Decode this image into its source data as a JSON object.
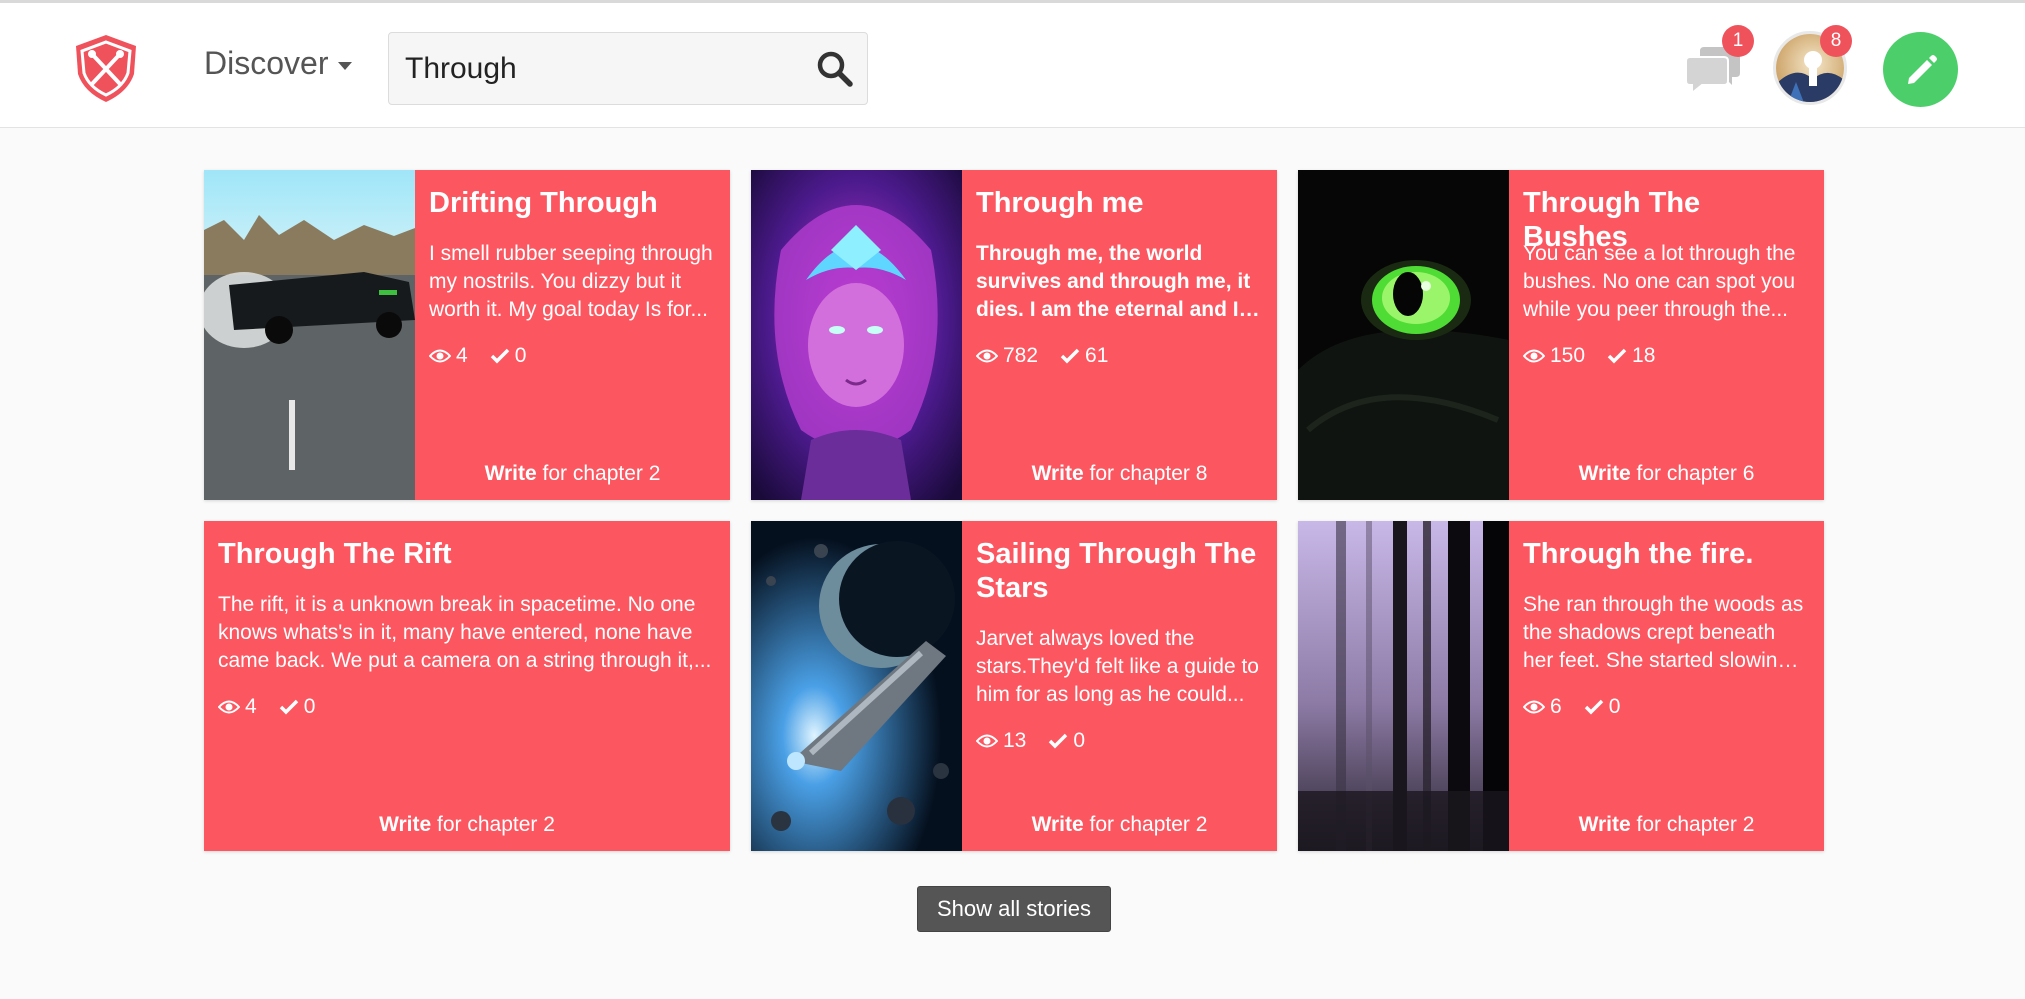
{
  "colors": {
    "accent": "#fc5760",
    "write_button": "#4ccf6b",
    "badge": "#f0525c"
  },
  "header": {
    "nav_label": "Discover",
    "search": {
      "value": "Through",
      "placeholder": ""
    },
    "messages_badge": "1",
    "notifications_badge": "8"
  },
  "stories": [
    {
      "title": "Drifting Through",
      "excerpt": "I smell rubber seeping through my nostrils. You dizzy but it worth it. My goal today Is for...",
      "views": "4",
      "completions": "0",
      "cta_action": "Write",
      "cta_rest": "for chapter 2"
    },
    {
      "title": "Through me",
      "excerpt": "Through me, the world survives and through me, it dies. I am the eternal and I a...",
      "views": "782",
      "completions": "61",
      "cta_action": "Write",
      "cta_rest": "for chapter 8"
    },
    {
      "title": "Through The Bushes",
      "excerpt": "You can see a lot through the bushes. No one can spot you while you peer through the...",
      "views": "150",
      "completions": "18",
      "cta_action": "Write",
      "cta_rest": "for chapter 6"
    },
    {
      "title": "Through The Rift",
      "excerpt": "The rift, it is a unknown break in spacetime. No one knows whats's in it, many have entered, none have came back. We put a camera on a string through it,...",
      "views": "4",
      "completions": "0",
      "cta_action": "Write",
      "cta_rest": "for chapter 2"
    },
    {
      "title": "Sailing Through The Stars",
      "excerpt": "Jarvet always loved the stars.They'd felt like a guide to him for as long as he could...",
      "views": "13",
      "completions": "0",
      "cta_action": "Write",
      "cta_rest": "for chapter 2"
    },
    {
      "title": "Through the fire.",
      "excerpt": "She ran through the woods as the shadows crept beneath her feet. She started slowing dow...",
      "views": "6",
      "completions": "0",
      "cta_action": "Write",
      "cta_rest": "for chapter 2"
    }
  ],
  "footer": {
    "show_all_label": "Show all stories"
  }
}
